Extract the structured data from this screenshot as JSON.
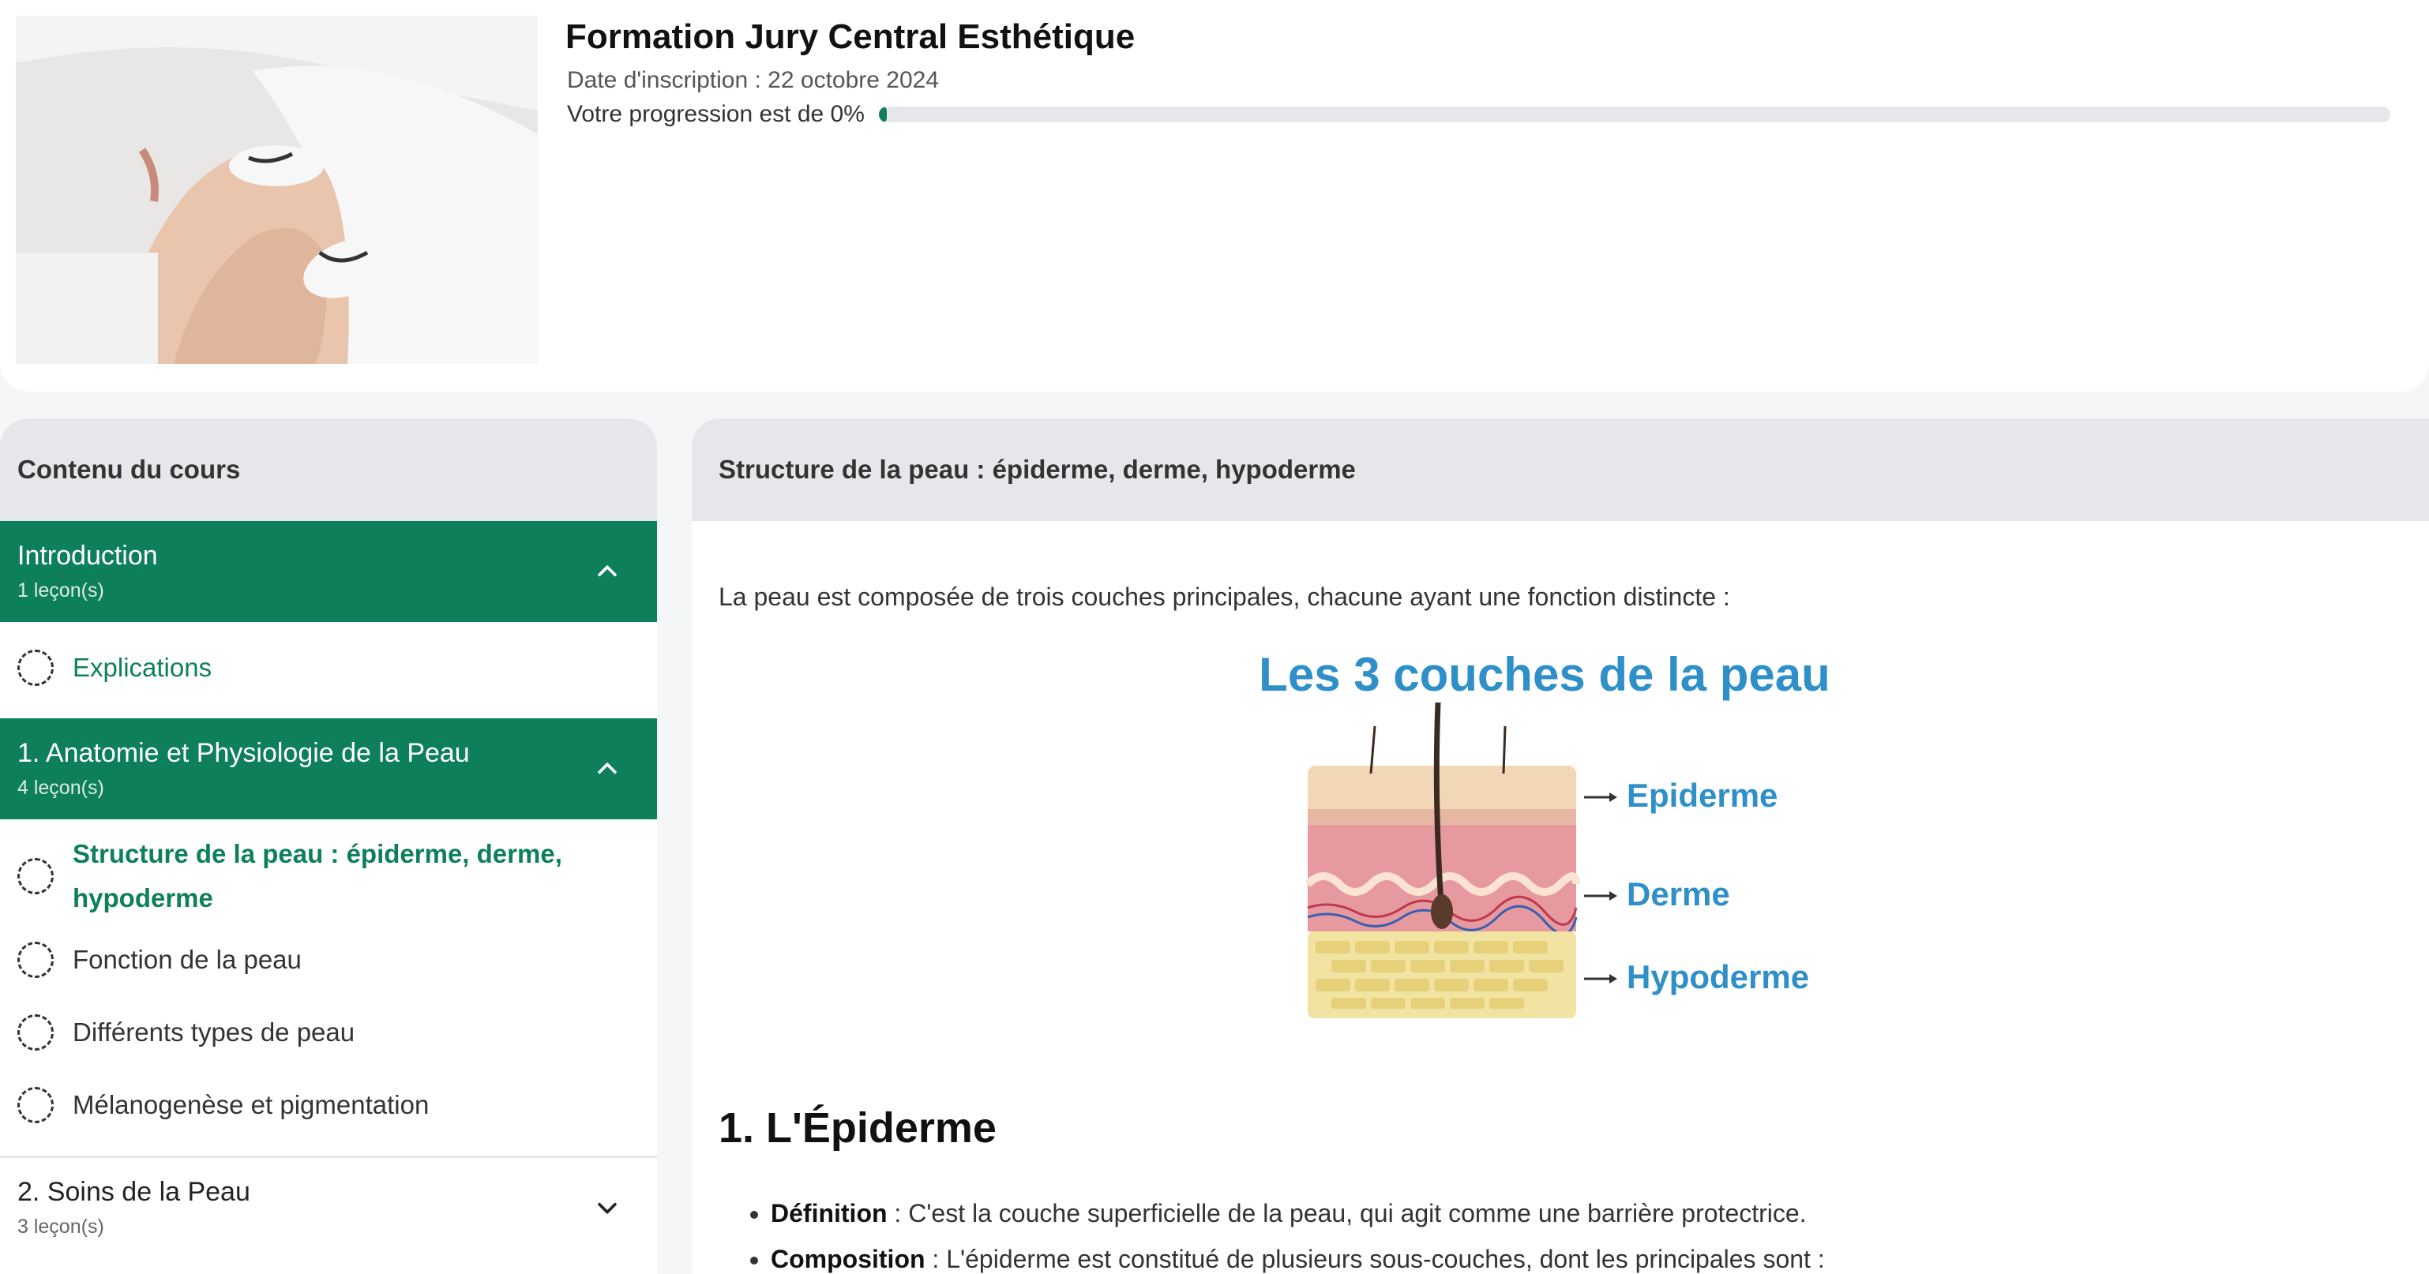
{
  "course": {
    "title": "Formation Jury Central Esthétique",
    "enrollment_date": "Date d'inscription : 22 octobre 2024",
    "progress_text": "Votre progression est de 0%",
    "progress_percent": 0
  },
  "sidebar": {
    "heading": "Contenu du cours",
    "sections": [
      {
        "title": "Introduction",
        "count": "1 leçon(s)",
        "expanded": true,
        "lessons": [
          {
            "label": "Explications"
          }
        ]
      },
      {
        "title": "1. Anatomie et Physiologie de la Peau",
        "count": "4 leçon(s)",
        "expanded": true,
        "lessons": [
          {
            "label": "Structure de la peau : épiderme, derme, hypoderme"
          },
          {
            "label": "Fonction de la peau"
          },
          {
            "label": "Différents types de peau"
          },
          {
            "label": "Mélanogenèse et pigmentation"
          }
        ]
      },
      {
        "title": "2. Soins de la Peau",
        "count": "3 leçon(s)",
        "expanded": false,
        "lessons": []
      }
    ]
  },
  "main": {
    "lesson_title": "Structure de la peau : épiderme, derme, hypoderme",
    "intro": "La peau est composée de trois couches principales, chacune ayant une fonction distincte :",
    "figure": {
      "title": "Les 3 couches de la peau",
      "labels": [
        "Epiderme",
        "Derme",
        "Hypoderme"
      ]
    },
    "section_heading": "1. L'Épiderme",
    "bullets": [
      {
        "term": "Définition",
        "text": " : C'est la couche superficielle de la peau, qui agit comme une barrière protectrice."
      },
      {
        "term": "Composition",
        "text": " : L'épiderme est constitué de plusieurs sous-couches, dont les principales sont :"
      }
    ]
  },
  "colors": {
    "accent": "#0e7f5b",
    "figure_blue": "#2e8fc9",
    "panel_header": "#e5e7eb"
  },
  "icons": [
    "chevron-up-icon",
    "chevron-down-icon",
    "lesson-status-icon"
  ]
}
